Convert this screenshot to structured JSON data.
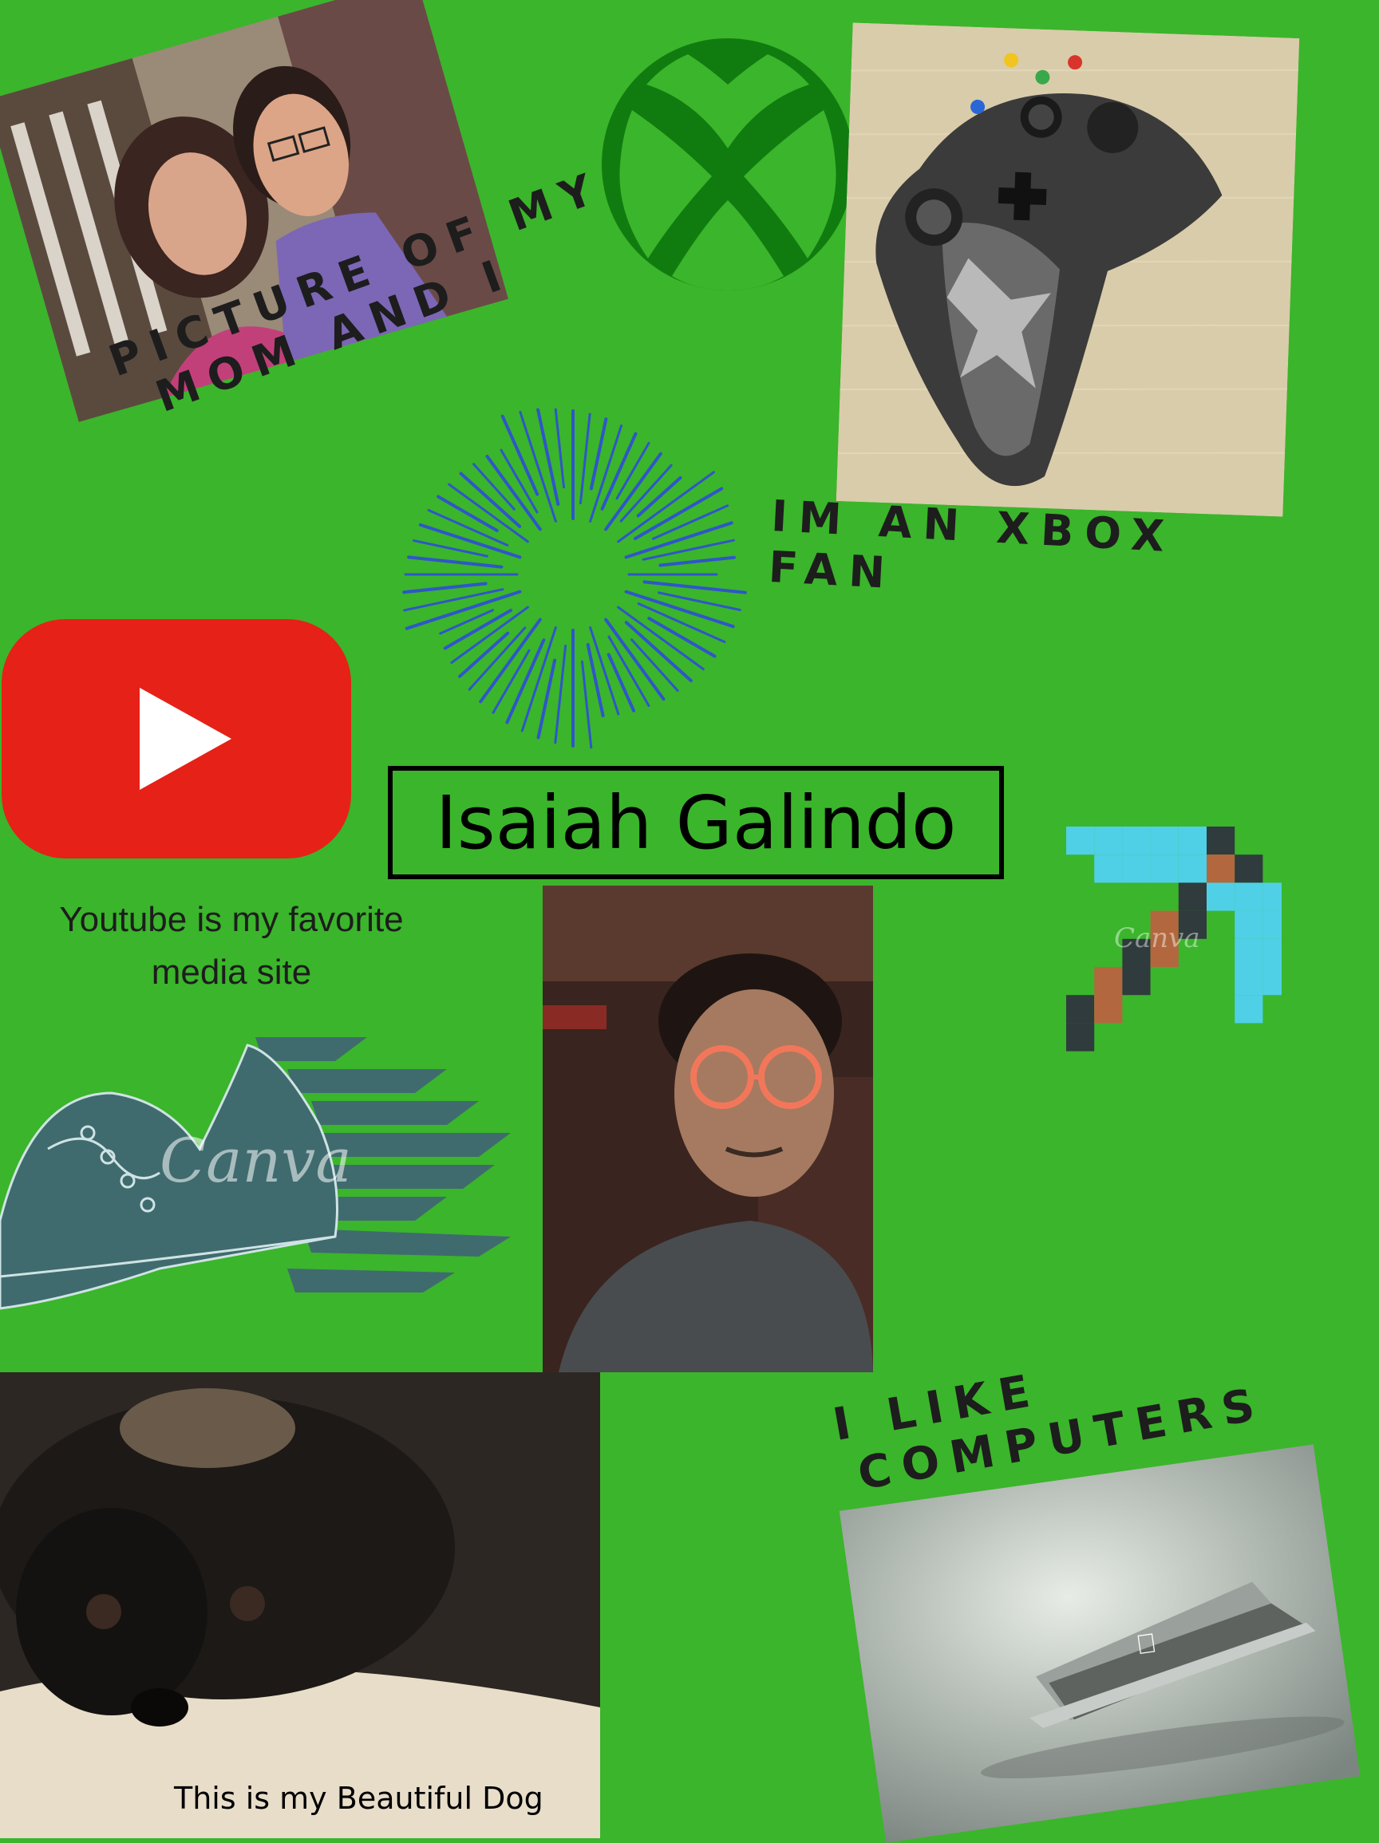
{
  "profile": {
    "name": "Isaiah Galindo"
  },
  "captions": {
    "mom_photo_line1": "PICTURE OF MY",
    "mom_photo_line2": "MOM AND I",
    "xbox_line1": "IM AN XBOX",
    "xbox_line2": "FAN",
    "youtube": "Youtube is my favorite media site",
    "computers_line1": "I LIKE",
    "computers_line2": "COMPUTERS",
    "dog": "This is my Beautiful Dog"
  },
  "watermarks": {
    "shoe": "Canva",
    "pickaxe": "Canva"
  },
  "icons": [
    "xbox-logo-icon",
    "youtube-logo-icon",
    "firework-burst-icon",
    "minecraft-pickaxe-icon",
    "running-shoe-icon",
    "apple-logo-icon"
  ],
  "colors": {
    "background": "#3bb52b",
    "xbox_green": "#107c10",
    "youtube_red": "#e62117",
    "burst_blue": "#2f56c9",
    "shoe_teal": "#3f6b6f",
    "pickaxe_cyan": "#4fd0e6",
    "text_dark": "#1d1d1d"
  }
}
